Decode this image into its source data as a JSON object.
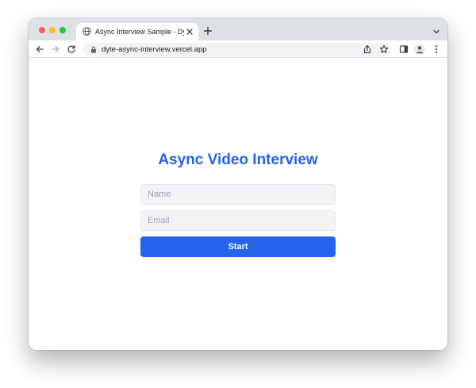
{
  "browser": {
    "tab": {
      "title": "Async Interview Sample - Dyte",
      "favicon": "globe-icon"
    },
    "address_bar": {
      "url": "dyte-async-interview.vercel.app"
    },
    "traffic_lights": [
      "#fe5f57",
      "#febc2e",
      "#28c840"
    ],
    "toolbar_icons": [
      "back-icon",
      "forward-icon",
      "reload-icon",
      "lock-icon",
      "share-icon",
      "star-icon",
      "side-panel-icon",
      "profile-icon",
      "kebab-menu-icon"
    ]
  },
  "page": {
    "heading": "Async Video Interview",
    "form": {
      "name_placeholder": "Name",
      "name_value": "",
      "email_placeholder": "Email",
      "email_value": "",
      "start_label": "Start"
    },
    "colors": {
      "accent": "#2563eb",
      "input_bg": "#f3f4f6"
    }
  }
}
